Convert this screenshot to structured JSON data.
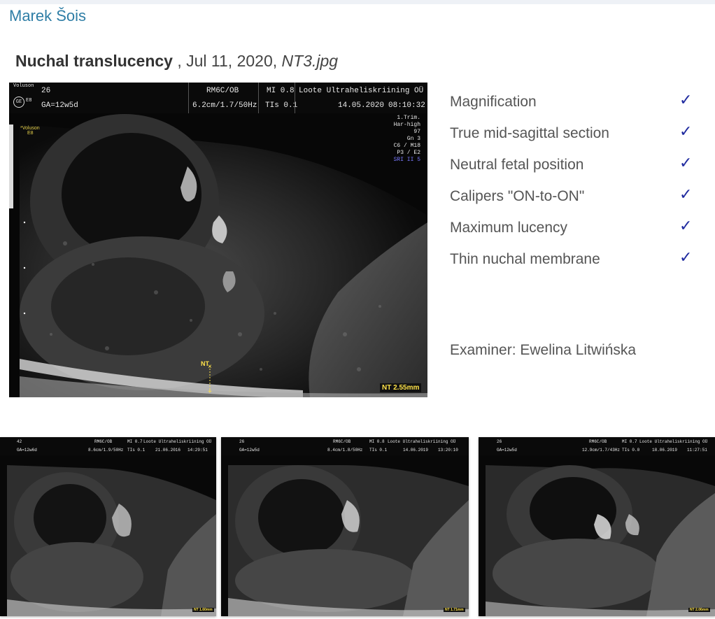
{
  "author": "Marek Šois",
  "record": {
    "title": "Nuchal translucency",
    "separator": " , ",
    "date": "Jul 11, 2020,",
    "filename": "NT3.jpg"
  },
  "main_image": {
    "logo": "Voluson",
    "logo_sub": "E8",
    "header": {
      "id": "26",
      "ga": "GA=12w5d",
      "probe": "RM6C/OB",
      "depth": "6.2cm/1.7/50Hz",
      "mi": "MI 0.8",
      "tis": "TIs 0.1",
      "clinic": "Loote Ultraheliskriining OÜ",
      "date": "14.05.2020",
      "time": "08:10:32"
    },
    "side_params": [
      "1.Trim.",
      "Har-high",
      "97",
      "Gn  3",
      "C6 / M18",
      "P3 / E2",
      "SRI II 5"
    ],
    "voluson_tag": "*Voluson",
    "voluson_tag2": "E8",
    "nt_marker": "NT",
    "nt_measurement": "NT 2.55mm"
  },
  "checklist": [
    {
      "label": "Magnification",
      "checked": true
    },
    {
      "label": "True mid-sagittal section",
      "checked": true
    },
    {
      "label": "Neutral fetal position",
      "checked": true
    },
    {
      "label": "Calipers \"ON-to-ON\"",
      "checked": true
    },
    {
      "label": "Maximum lucency",
      "checked": true
    },
    {
      "label": "Thin nuchal membrane",
      "checked": true
    }
  ],
  "check_glyph": "✓",
  "examiner": "Examiner: Ewelina Litwińska",
  "thumbnails": [
    {
      "id": "42",
      "ga": "GA=12w6d",
      "probe": "RM6C/OB",
      "depth": "8.6cm/1.9/50Hz",
      "mi": "MI 0.7",
      "tis": "TIs 0.1",
      "clinic": "Loote Ultraheliskriining OÜ",
      "date": "21.06.2016",
      "time": "14:29:51",
      "nt": "NT 1.60mm"
    },
    {
      "id": "26",
      "ga": "GA=12w5d",
      "probe": "RM6C/OB",
      "depth": "8.4cm/1.8/50Hz",
      "mi": "MI 0.8",
      "tis": "TIs 0.1",
      "clinic": "Loote Ultraheliskriining OÜ",
      "date": "14.06.2019",
      "time": "13:20:10",
      "nt": "NT 1.71mm"
    },
    {
      "id": "26",
      "ga": "GA=12w5d",
      "probe": "RM6C/OB",
      "depth": "12.9cm/1.7/43Hz",
      "mi": "MI 0.7",
      "tis": "TIs 0.0",
      "clinic": "Loote Ultraheliskriining OÜ",
      "date": "18.06.2019",
      "time": "11:27:51",
      "nt": "NT 2.06mm"
    }
  ]
}
